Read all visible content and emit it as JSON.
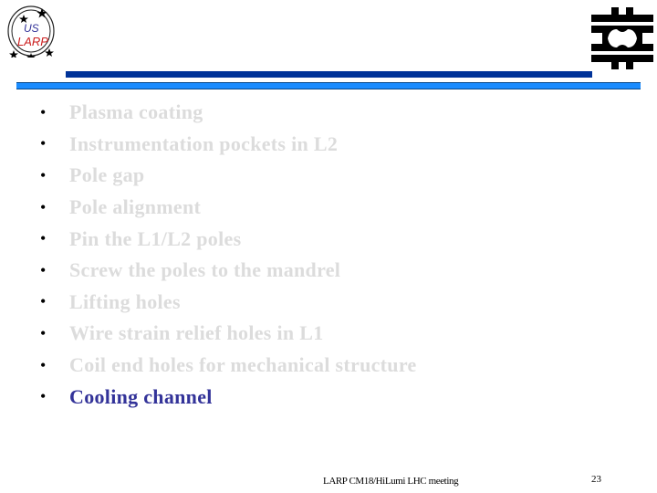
{
  "logos": {
    "left": {
      "icon": "us-larp-logo",
      "line1": "US",
      "line2": "LARP"
    },
    "right": {
      "icon": "fermilab-logo"
    }
  },
  "colors": {
    "bar_dark": "#003399",
    "bar_light": "#1a8cff",
    "text_dimmed": "#dcdcdc",
    "text_active": "#333399"
  },
  "bullets": [
    {
      "text": "Plasma coating",
      "active": false
    },
    {
      "text": "Instrumentation pockets in L2",
      "active": false
    },
    {
      "text": "Pole gap",
      "active": false
    },
    {
      "text": "Pole alignment",
      "active": false
    },
    {
      "text": "Pin the L1/L2 poles",
      "active": false
    },
    {
      "text": "Screw the poles to the mandrel",
      "active": false
    },
    {
      "text": "Lifting holes",
      "active": false
    },
    {
      "text": "Wire strain relief holes in L1",
      "active": false
    },
    {
      "text": "Coil end holes for mechanical structure",
      "active": false
    },
    {
      "text": "Cooling channel",
      "active": true
    }
  ],
  "bullet_glyph": "•",
  "footer": {
    "text": "LARP CM18/HiLumi LHC meeting",
    "page_number": "23"
  }
}
